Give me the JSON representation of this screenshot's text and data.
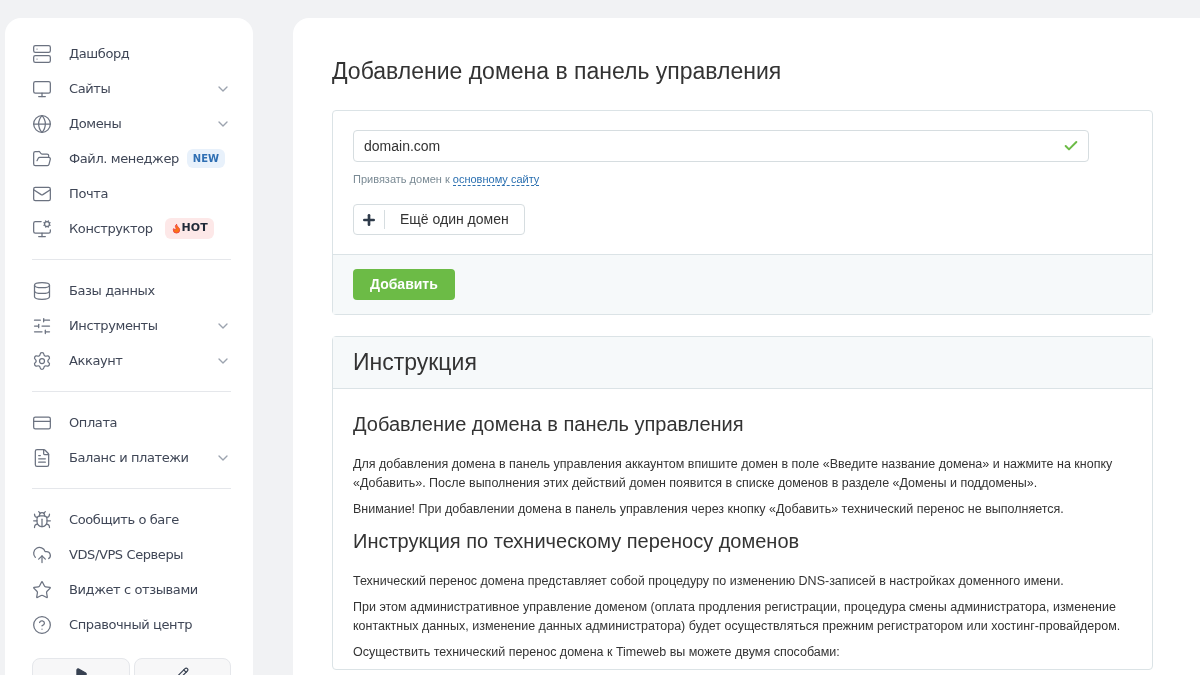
{
  "sidebar": {
    "groups": [
      {
        "items": [
          {
            "label": "Дашборд",
            "expandable": false
          },
          {
            "label": "Сайты",
            "expandable": true
          },
          {
            "label": "Домены",
            "expandable": true
          },
          {
            "label": "Файл. менеджер",
            "expandable": false,
            "badge": {
              "kind": "new",
              "text": "NEW"
            }
          },
          {
            "label": "Почта",
            "expandable": false
          },
          {
            "label": "Конструктор",
            "expandable": false,
            "badge": {
              "kind": "hot",
              "text": "HOT"
            }
          }
        ]
      },
      {
        "items": [
          {
            "label": "Базы данных",
            "expandable": false
          },
          {
            "label": "Инструменты",
            "expandable": true
          },
          {
            "label": "Аккаунт",
            "expandable": true
          }
        ]
      },
      {
        "items": [
          {
            "label": "Оплата",
            "expandable": false
          },
          {
            "label": "Баланс и платежи",
            "expandable": true
          }
        ]
      },
      {
        "items": [
          {
            "label": "Сообщить о баге",
            "expandable": false
          },
          {
            "label": "VDS/VPS Серверы",
            "expandable": false
          },
          {
            "label": "Виджет с отзывами",
            "expandable": false
          },
          {
            "label": "Справочный центр",
            "expandable": false
          }
        ]
      }
    ]
  },
  "page_title": "Добавление домена в панель управления",
  "form": {
    "domain_value": "domain.com",
    "valid": true,
    "hint": "Привязать домен к",
    "hint_link": "основному сайту",
    "add_more_button": "Ещё один домен",
    "submit_button": "Добавить"
  },
  "instructions": {
    "title": "Инструкция",
    "sections": [
      {
        "heading": "Добавление домена в панель управления",
        "paragraphs": [
          "Для добавления домена в панель управления аккаунтом впишите домен в поле «Введите название домена» и нажмите на кнопку «Добавить». После выполнения этих действий домен появится в списке доменов в разделе «Домены и поддомены».",
          "Внимание! При добавлении домена в панель управления через кнопку «Добавить» технический перенос не выполняется."
        ]
      },
      {
        "heading": "Инструкция по техническому переносу доменов",
        "paragraphs": [
          "Технический перенос домена представляет собой процедуру по изменению DNS-записей в настройках доменного имени.",
          "При этом административное управление доменом (оплата продления регистрации, процедура смены администратора, изменение контактных данных, изменение данных администратора) будет осуществляться прежним регистратором или хостинг-провайдером.",
          "Осуществить технический перенос домена к Timeweb вы можете двумя способами:"
        ]
      }
    ]
  }
}
